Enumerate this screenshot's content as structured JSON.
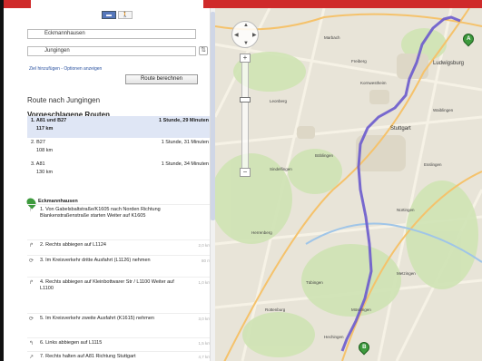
{
  "modes": {
    "car": "▬",
    "walk": "🚶"
  },
  "waypoints": {
    "a_letter": "A",
    "a_value": "Eckmannhausen",
    "b_letter": "B",
    "b_value": "Jungingen"
  },
  "links": {
    "add": "Ziel hinzufügen - Optionen anzeigen"
  },
  "calc_button": "Route berechnen",
  "route_heading": "Route nach Jungingen",
  "suggested_heading": "Vorgeschlagene Routen",
  "routes": [
    {
      "name": "1. A81 und B27",
      "time": "1 Stunde, 29 Minuten",
      "km": "117 km"
    },
    {
      "name": "2. B27",
      "time": "1 Stunde, 31 Minuten",
      "km": "108 km"
    },
    {
      "name": "3. A81",
      "time": "1 Stunde, 34 Minuten",
      "km": "130 km"
    }
  ],
  "start_label": "Eckmannhausen",
  "steps": [
    {
      "icon": "↑",
      "text": "1. Von Gabelsbaltstraße/K1605 nach Norden Richtung Blankenstraßenstraße starten Weiter auf K1605",
      "dist": ""
    },
    {
      "icon": "↱",
      "text": "2. Rechts abbiegen auf L1124",
      "dist": "2,0 km"
    },
    {
      "icon": "⟳",
      "text": "3. Im Kreisverkehr dritte Ausfahrt (L1126) nehmen",
      "dist": "80 m"
    },
    {
      "icon": "↱",
      "text": "4. Rechts abbiegen auf Kleinbottwarer Str / L1100 Weiter auf L1100",
      "dist": "1,0 km"
    },
    {
      "icon": "⟳",
      "text": "5. Im Kreisverkehr zweite Ausfahrt (K1615) nehmen",
      "dist": "3,0 km"
    },
    {
      "icon": "↰",
      "text": "6. Links abbiegen auf L1115",
      "dist": "1,5 km"
    },
    {
      "icon": "↗",
      "text": "7. Rechts halten auf A81 Richtung Stuttgart",
      "dist": "4,7 km"
    }
  ],
  "map": {
    "city_stuttgart": "Stuttgart",
    "city_ludwigsburg": "Ludwigsburg",
    "marker_a": "A",
    "marker_b": "B",
    "pan_up": "▲",
    "pan_down": "▼",
    "pan_left": "◀",
    "pan_right": "▶",
    "zoom_in": "+",
    "zoom_out": "−",
    "towns": [
      "Marbach",
      "Freiberg",
      "Kornwestheim",
      "Leonberg",
      "Böblingen",
      "Sindelfingen",
      "Herrenberg",
      "Tübingen",
      "Rottenburg",
      "Hechingen",
      "Esslingen",
      "Waiblingen",
      "Nürtingen",
      "Metzingen",
      "Mössingen"
    ]
  },
  "colors": {
    "route": "#6a5acd",
    "marker": "#3d9a3d",
    "topbar": "#cf2a2a"
  }
}
